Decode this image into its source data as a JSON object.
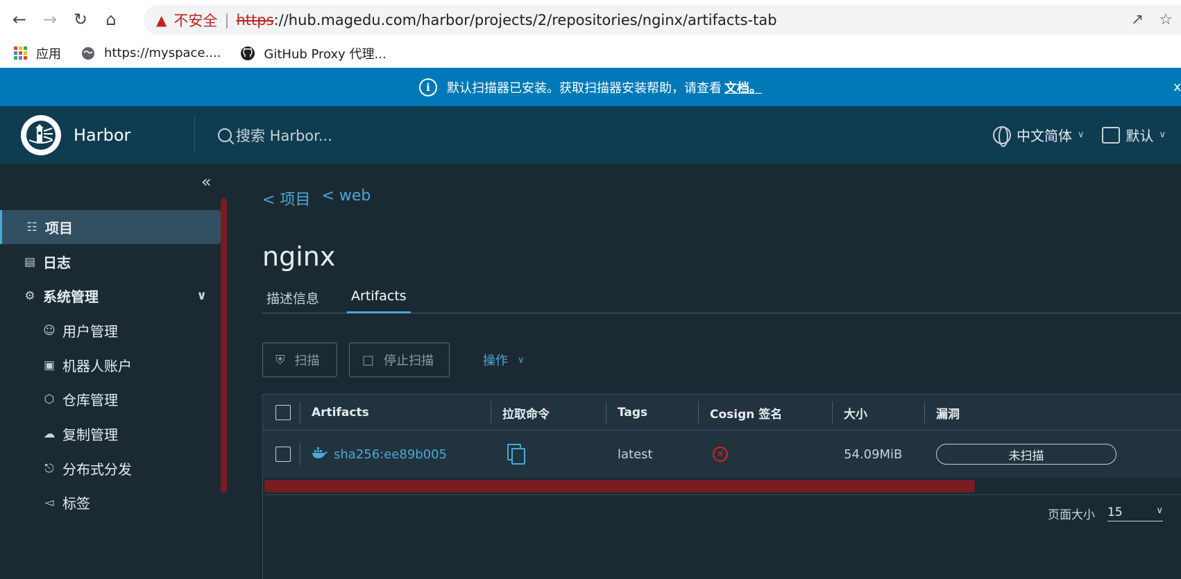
{
  "browser": {
    "back_icon": "arrow-left",
    "forward_icon": "arrow-right",
    "reload_icon": "reload",
    "home_icon": "home",
    "insecure_label": "不安全",
    "url_scheme": "https",
    "url_rest": "://hub.magedu.com/harbor/projects/2/repositories/nginx/artifacts-tab",
    "bookmarks": [
      {
        "label": "应用"
      },
      {
        "label": "https://myspace...."
      },
      {
        "label": "GitHub Proxy 代理..."
      }
    ]
  },
  "banner": {
    "text": "默认扫描器已安装。获取扫描器安装帮助，请查看",
    "link": "文档。",
    "close": "x"
  },
  "header": {
    "brand": "Harbor",
    "search_placeholder": "搜索 Harbor...",
    "language": "中文简体",
    "datetime_format": "默认"
  },
  "sidebar": {
    "items": [
      {
        "label": "项目",
        "icon": "projects-icon"
      },
      {
        "label": "日志",
        "icon": "logs-icon"
      },
      {
        "label": "系统管理",
        "icon": "admin-icon"
      },
      {
        "label": "用户管理",
        "icon": "users-icon"
      },
      {
        "label": "机器人账户",
        "icon": "robot-icon"
      },
      {
        "label": "仓库管理",
        "icon": "registry-icon"
      },
      {
        "label": "复制管理",
        "icon": "replication-icon"
      },
      {
        "label": "分布式分发",
        "icon": "distribution-icon"
      },
      {
        "label": "标签",
        "icon": "label-icon"
      }
    ]
  },
  "main": {
    "breadcrumbs": [
      "< 项目",
      "< web"
    ],
    "title": "nginx",
    "tabs": [
      "描述信息",
      "Artifacts"
    ],
    "buttons": {
      "scan": "扫描",
      "stop_scan": "停止扫描",
      "actions": "操作"
    },
    "table": {
      "columns": [
        "Artifacts",
        "拉取命令",
        "Tags",
        "Cosign 签名",
        "大小",
        "漏洞"
      ],
      "rows": [
        {
          "artifact": "sha256:ee89b005",
          "tags": "latest",
          "size": "54.09MiB",
          "vulnerability": "未扫描"
        }
      ],
      "page_size_label": "页面大小",
      "page_size": "15"
    }
  },
  "colors": {
    "header_bg": "#0f3c51",
    "banner_bg": "#0079b8",
    "accent": "#4aa8da",
    "sidebar_active": "#324f61",
    "page_bg": "#1b2a32"
  }
}
